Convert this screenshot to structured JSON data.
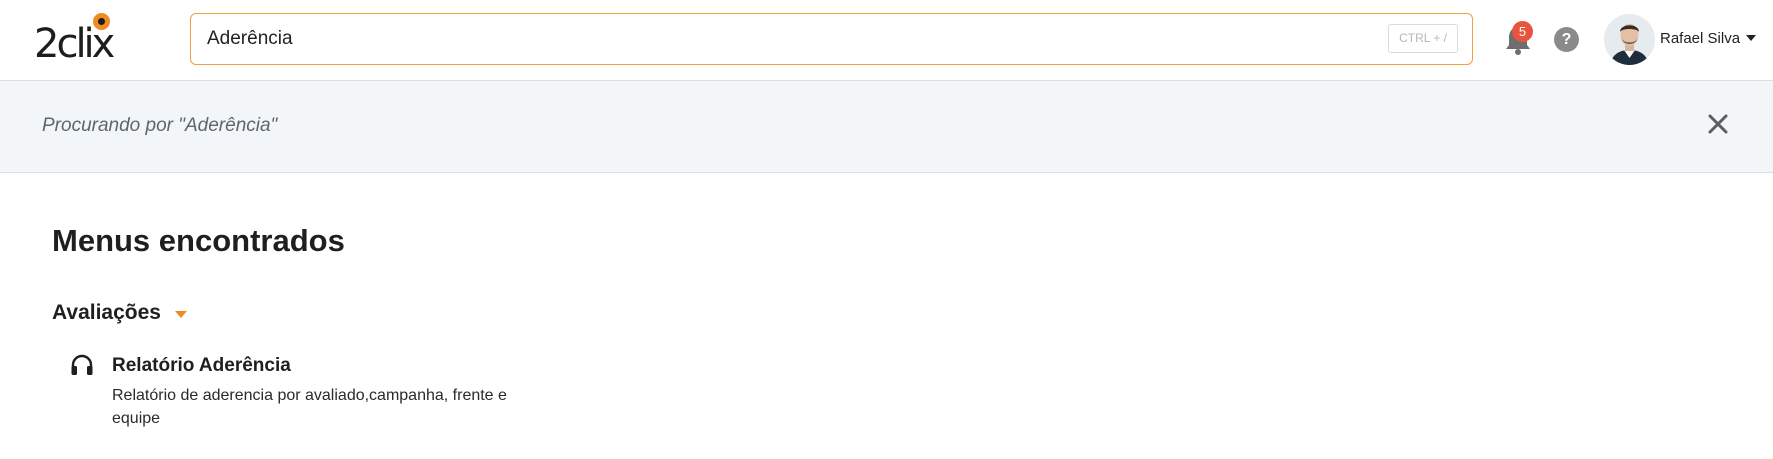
{
  "header": {
    "logo_text": "2clix",
    "search": {
      "value": "Aderência",
      "shortcut": "CTRL + /"
    },
    "notifications": {
      "icon": "bell-icon",
      "count": "5"
    },
    "help": {
      "icon": "help-icon",
      "label": "?"
    },
    "user": {
      "name": "Rafael Silva",
      "icon": "chevron-down-icon"
    }
  },
  "search_banner": {
    "text": "Procurando por \"Aderência\"",
    "close_icon": "close-icon"
  },
  "results": {
    "section_title": "Menus encontrados",
    "groups": [
      {
        "title": "Avaliações",
        "items": [
          {
            "icon": "headphones-icon",
            "title": "Relatório Aderência",
            "description": "Relatório de aderencia por avaliado,campanha, frente e equipe"
          }
        ]
      }
    ]
  },
  "colors": {
    "accent": "#f08a24",
    "badge": "#e8543e",
    "banner_bg": "#f3f6f9"
  }
}
